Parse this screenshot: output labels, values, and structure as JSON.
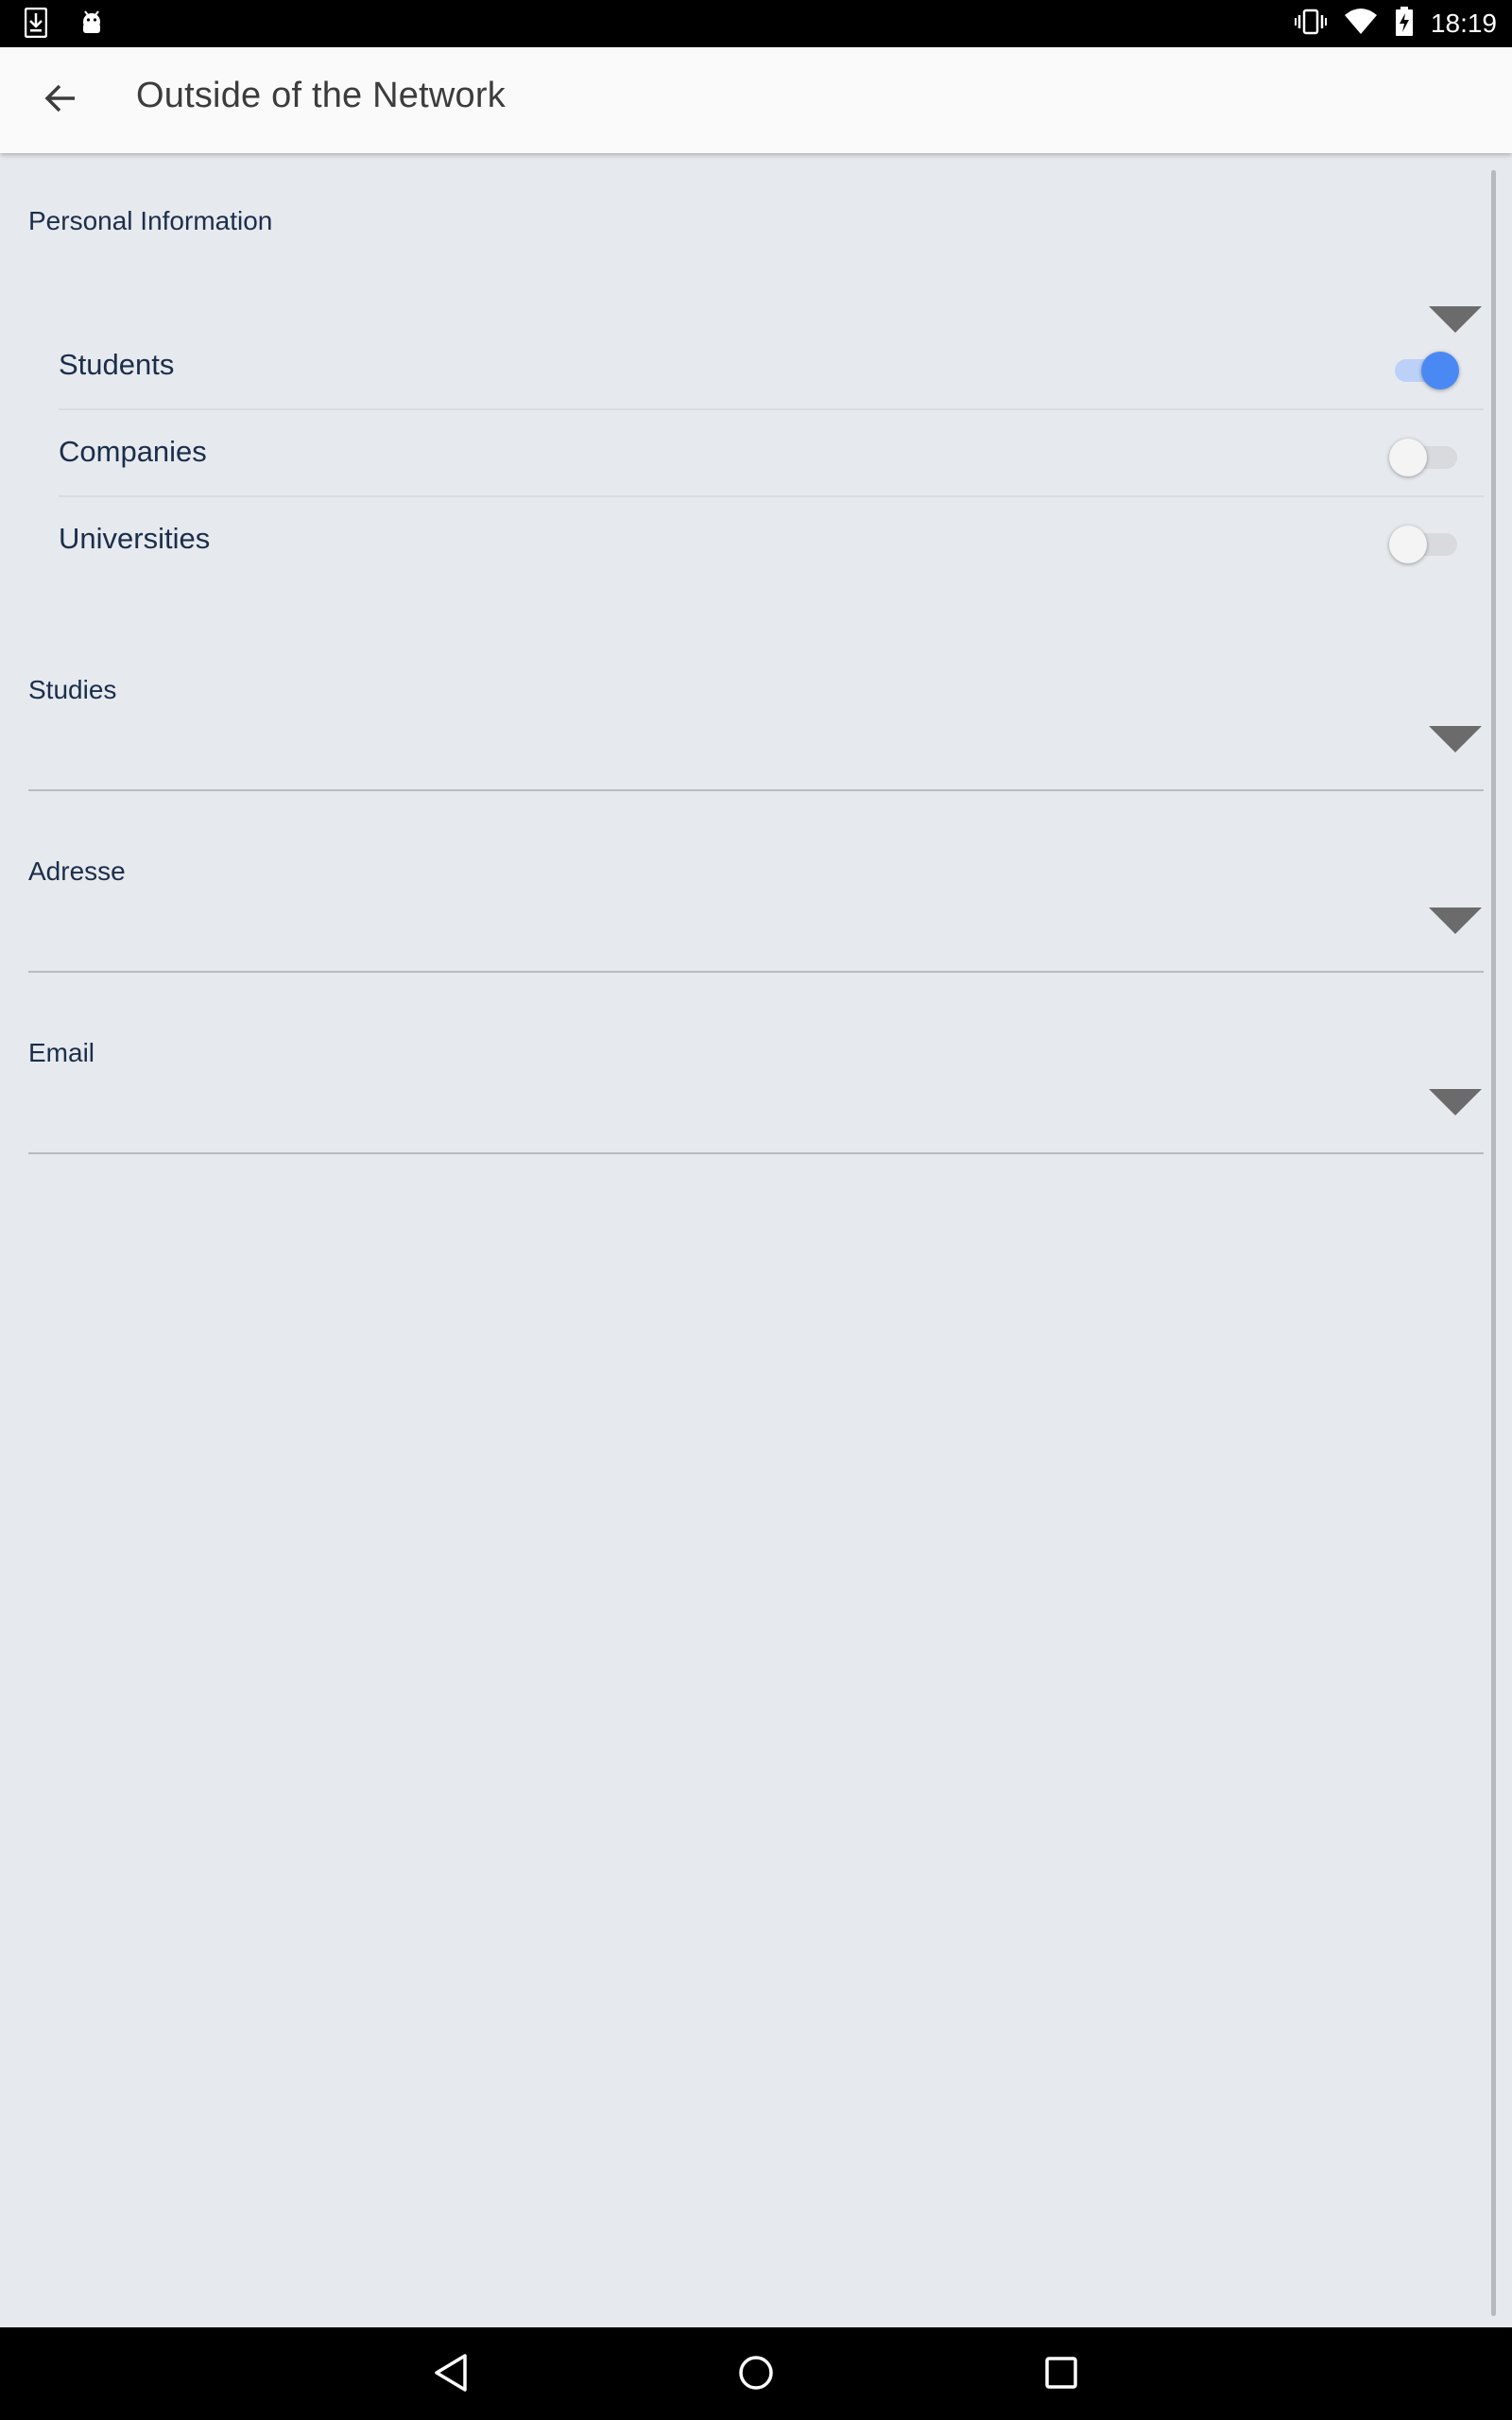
{
  "status_bar": {
    "time": "18:19",
    "left_icons": [
      "download-icon",
      "android-debug-icon"
    ],
    "right_icons": [
      "vibrate-icon",
      "wifi-icon",
      "battery-charging-icon"
    ]
  },
  "app_bar": {
    "title": "Outside of the Network",
    "back_icon": "arrow-back-icon"
  },
  "sections": [
    {
      "label": "Personal Information",
      "expanded": true,
      "items": [
        {
          "label": "Students",
          "enabled": true
        },
        {
          "label": "Companies",
          "enabled": false
        },
        {
          "label": "Universities",
          "enabled": false
        }
      ]
    },
    {
      "label": "Studies",
      "expanded": false
    },
    {
      "label": "Adresse",
      "expanded": false
    },
    {
      "label": "Email",
      "expanded": false
    }
  ],
  "colors": {
    "background": "#e6e9ee",
    "accent": "#4a89f3",
    "text": "#1b2e4a"
  },
  "nav_bar": {
    "icons": [
      "nav-back-icon",
      "nav-home-icon",
      "nav-recents-icon"
    ]
  }
}
